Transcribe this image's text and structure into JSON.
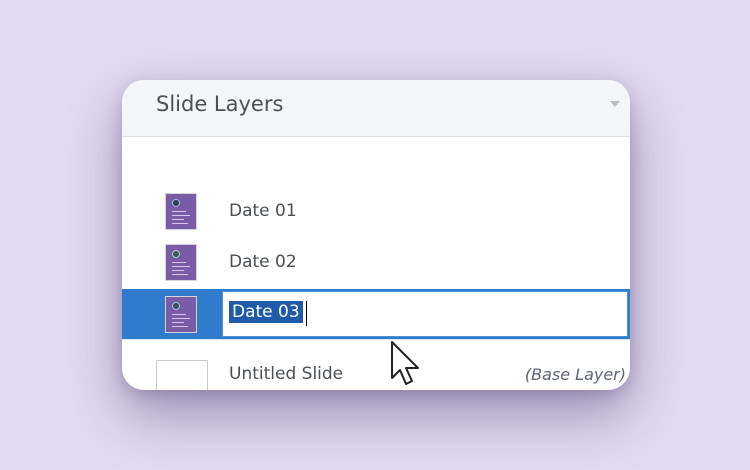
{
  "panel": {
    "title": "Slide Layers",
    "layers": [
      {
        "name": "Date 01",
        "icon": "slide-thumbnail-icon"
      },
      {
        "name": "Date 02",
        "icon": "slide-thumbnail-icon"
      },
      {
        "name": "Date 03",
        "icon": "slide-thumbnail-icon",
        "editing": true
      }
    ],
    "base": {
      "name": "Untitled Slide",
      "tag": "(Base Layer)"
    }
  },
  "colors": {
    "background": "#e2daf1",
    "selection": "#2f7bcc",
    "text_selection": "#1f5ba8",
    "thumbnail": "#7a5ba5"
  }
}
